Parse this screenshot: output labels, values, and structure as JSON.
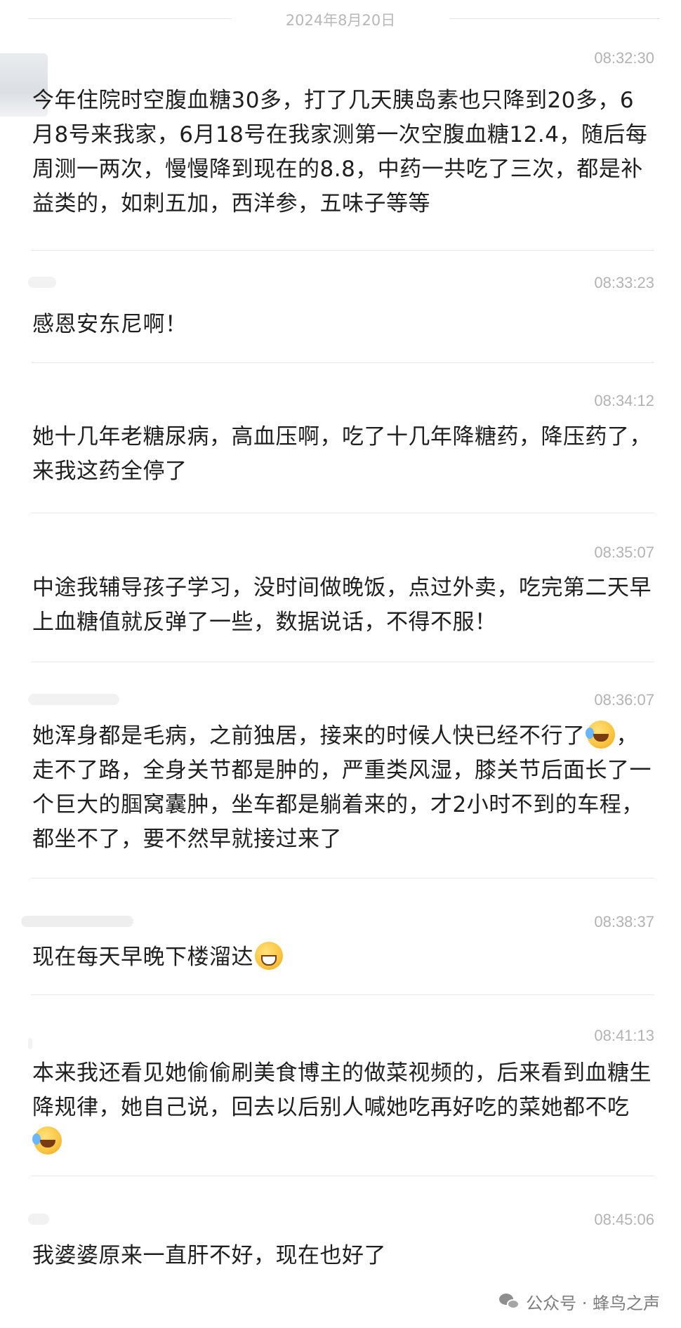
{
  "date_divider": "2024年8月20日",
  "messages": [
    {
      "time": "08:32:30",
      "text": "今年住院时空腹血糖30多，打了几天胰岛素也只降到20多，6月8号来我家，6月18号在我家测第一次空腹血糖12.4，随后每周测一两次，慢慢降到现在的8.8，中药一共吃了三次，都是补益类的，如刺五加，西洋参，五味子等等"
    },
    {
      "time": "08:33:23",
      "text": "感恩安东尼啊！"
    },
    {
      "time": "08:34:12",
      "text": "她十几年老糖尿病，高血压啊，吃了十几年降糖药，降压药了，来我这药全停了"
    },
    {
      "time": "08:35:07",
      "text": "中途我辅导孩子学习，没时间做晚饭，点过外卖，吃完第二天早上血糖值就反弹了一些，数据说话，不得不服！"
    },
    {
      "time": "08:36:07",
      "text_a": "她浑身都是毛病，之前独居，接来的时候人快已经不行了",
      "emoji_a": "loudly-crying-emoji",
      "text_b": "，走不了路，全身关节都是肿的，严重类风湿，膝关节后面长了一个巨大的腘窝囊肿，坐车都是躺着来的，才2小时不到的车程，都坐不了，要不然早就接过来了"
    },
    {
      "time": "08:38:37",
      "text": "现在每天早晚下楼溜达",
      "emoji": "grinning-emoji"
    },
    {
      "time": "08:41:13",
      "text": "本来我还看见她偷偷刷美食博主的做菜视频的，后来看到血糖生降规律，她自己说，回去以后别人喊她吃再好吃的菜她都不吃",
      "emoji": "laughing-tears-emoji"
    },
    {
      "time": "08:45:06",
      "text": "我婆婆原来一直肝不好，现在也好了"
    }
  ],
  "footer": {
    "icon": "wechat-icon",
    "text": "公众号 · 蜂鸟之声"
  }
}
